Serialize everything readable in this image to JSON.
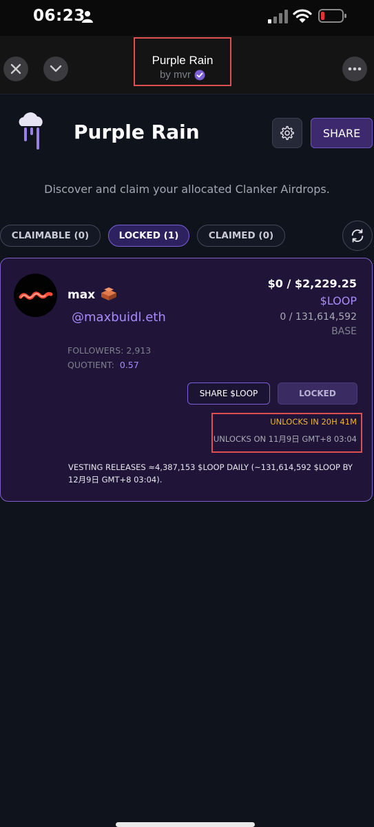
{
  "status_bar": {
    "time": "06:23"
  },
  "nav": {
    "title": "Purple Rain",
    "subtitle": "by mvr"
  },
  "header": {
    "brand": "Purple Rain",
    "share_label": "SHARE",
    "tagline": "Discover and claim your allocated Clanker Airdrops."
  },
  "tabs": [
    {
      "label": "CLAIMABLE (0)"
    },
    {
      "label": "LOCKED (1)"
    },
    {
      "label": "CLAIMED (0)"
    }
  ],
  "card": {
    "name": "max",
    "handle": "@maxbuidl.eth",
    "value": "$0 / $2,229.25",
    "token": "$LOOP",
    "amount": "0 / 131,614,592",
    "chain": "BASE",
    "followers_label": "FOLLOWERS:",
    "followers_value": "2,913",
    "quotient_label": "QUOTIENT:",
    "quotient_value": "0.57",
    "share_button": "SHARE $LOOP",
    "locked_button": "LOCKED",
    "unlocks_in": "UNLOCKS IN 20H 41M",
    "unlocks_on": "UNLOCKS ON 11月9日 GMT+8 03:04",
    "vesting": "VESTING RELEASES ≈4,387,153 $LOOP DAILY (~131,614,592 $LOOP BY 12月9日 GMT+8 03:04)."
  },
  "colors": {
    "accent": "#7c5fd6",
    "accent_text": "#a78bfa",
    "warning": "#f0b429",
    "highlight_box": "#e0504f"
  },
  "icons": [
    "person-icon",
    "signal-icon",
    "wifi-icon",
    "battery-icon",
    "close-icon",
    "chevron-down-icon",
    "more-icon",
    "verified-badge-icon",
    "rain-cloud-logo",
    "gear-icon",
    "refresh-icon",
    "brick-icon"
  ]
}
